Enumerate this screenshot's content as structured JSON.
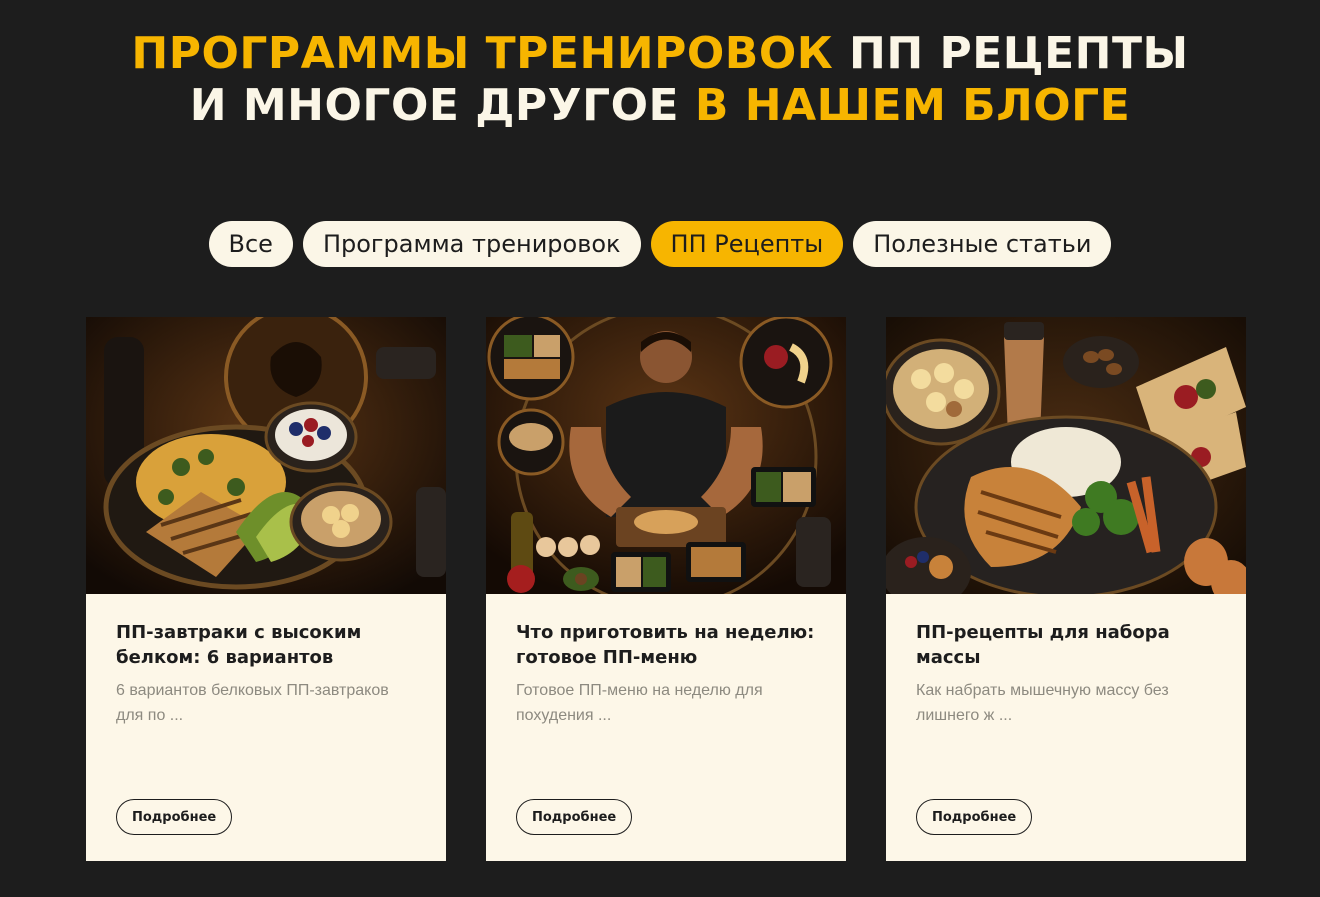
{
  "headline": {
    "line1_yellow": "ПРОГРАММЫ ТРЕНИРОВОК",
    "line1_white": "ПП РЕЦЕПТЫ",
    "line2_white": "И МНОГОЕ ДРУГОЕ",
    "line2_yellow": "В НАШЕМ БЛОГЕ"
  },
  "filters": [
    {
      "label": "Все",
      "active": false
    },
    {
      "label": "Программа тренировок",
      "active": false
    },
    {
      "label": "ПП Рецепты",
      "active": true
    },
    {
      "label": "Полезные статьи",
      "active": false
    }
  ],
  "cards": [
    {
      "title": "ПП-завтраки с высоким белком: 6 вариантов",
      "description": "6 вариантов белковых ПП-завтраков для по ...",
      "button": "Подробнее"
    },
    {
      "title": "Что приготовить на неделю: готовое ПП-меню",
      "description": "Готовое ПП-меню на неделю для похудения ...",
      "button": "Подробнее"
    },
    {
      "title": "ПП-рецепты для набора массы",
      "description": "Как набрать мышечную массу без лишнего ж ...",
      "button": "Подробнее"
    }
  ],
  "colors": {
    "background": "#1d1d1d",
    "accent": "#f7b500",
    "cream": "#fbf6e7",
    "muted_text": "#8d8a80"
  }
}
